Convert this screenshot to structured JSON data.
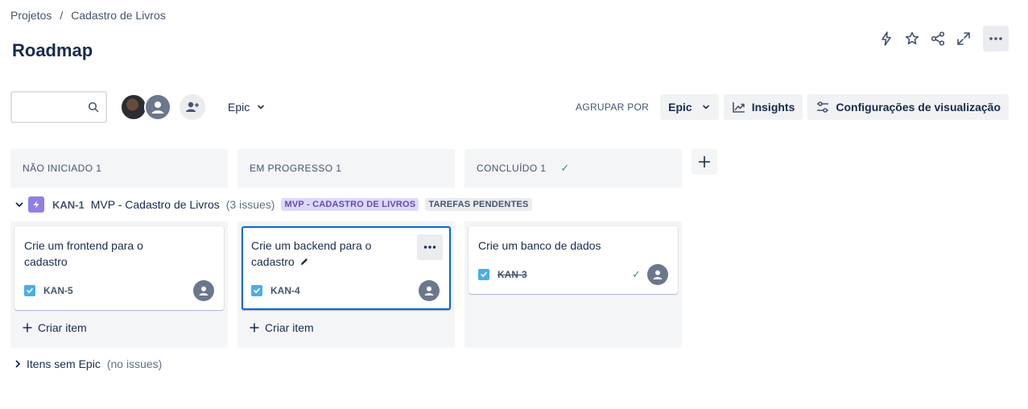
{
  "breadcrumb": {
    "items": [
      "Projetos",
      "Cadastro de Livros"
    ],
    "separator": "/"
  },
  "page": {
    "title": "Roadmap"
  },
  "top_actions": [
    "lightning-icon",
    "star-icon",
    "share-icon",
    "expand-icon",
    "more-icon"
  ],
  "toolbar": {
    "search_placeholder": "",
    "epic_filter_label": "Epic",
    "group_by_label": "AGRUPAR POR",
    "group_by_value": "Epic",
    "insights_label": "Insights",
    "view_settings_label": "Configurações de visualização"
  },
  "columns": [
    {
      "title": "NÃO INICIADO 1"
    },
    {
      "title": "EM PROGRESSO 1"
    },
    {
      "title": "CONCLUÍDO 1"
    }
  ],
  "epic": {
    "key": "KAN-1",
    "name": "MVP - Cadastro de Livros",
    "count": "(3 issues)",
    "lozenge_epic": "MVP - CADASTRO DE LIVROS",
    "lozenge_status": "TAREFAS PENDENTES"
  },
  "cards": [
    {
      "title": "Crie um frontend para o cadastro",
      "key": "KAN-5"
    },
    {
      "title": "Crie um backend para o cadastro",
      "key": "KAN-4"
    },
    {
      "title": "Crie um banco de dados",
      "key": "KAN-3"
    }
  ],
  "create_label": "Criar item",
  "no_epic": {
    "label": "Itens sem Epic",
    "count": "(no issues)"
  },
  "colors": {
    "accent": "#0c66e4",
    "epic": "#8f7ee7",
    "done": "#22a06b",
    "task": "#4bade8"
  }
}
